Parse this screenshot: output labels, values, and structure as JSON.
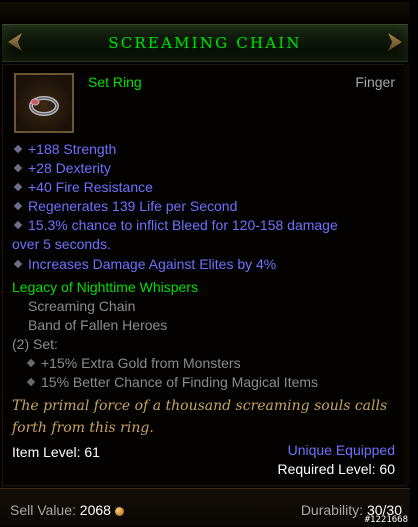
{
  "item": {
    "name": "SCREAMING CHAIN",
    "type": "Set Ring",
    "slot": "Finger",
    "icon": "ring-icon",
    "name_color": "#00e000"
  },
  "stats": [
    "+188 Strength",
    "+28 Dexterity",
    "+40 Fire Resistance",
    "Regenerates 139 Life per Second",
    "15.3% chance to inflict Bleed for 120-158 damage",
    "over 5 seconds.",
    "Increases Damage Against Elites by 4%"
  ],
  "set": {
    "name": "Legacy of Nighttime Whispers",
    "pieces": [
      "Screaming Chain",
      "Band of Fallen Heroes"
    ],
    "bonus_header": "(2) Set:",
    "bonuses": [
      "+15% Extra Gold from Monsters",
      "15% Better Chance of Finding Magical Items"
    ]
  },
  "flavor": {
    "line1": "The primal force of a thousand screaming souls calls",
    "line2": "forth from this ring."
  },
  "item_level": "Item Level: 61",
  "unique_equipped": "Unique Equipped",
  "required_level": "Required Level: 60",
  "footer": {
    "sell_label": "Sell Value:",
    "sell_value": "2068",
    "durability_label": "Durability:",
    "durability_value": "30/30"
  },
  "watermark": "#1221668",
  "colors": {
    "stat_blue": "#7070ff",
    "set_green": "#00e000",
    "flavor_gold": "#c8a464"
  }
}
